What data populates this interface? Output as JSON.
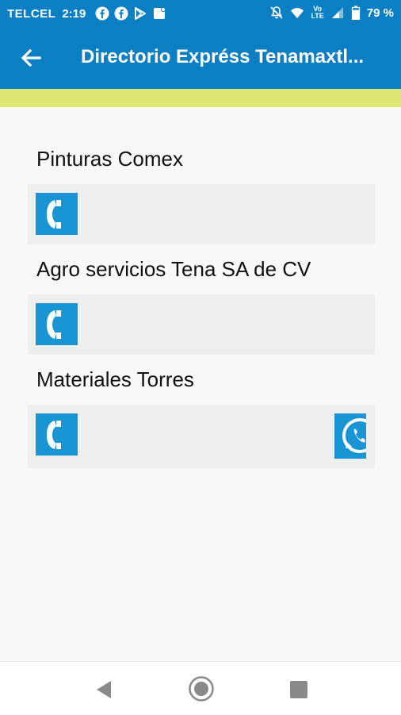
{
  "status_bar": {
    "carrier": "TELCEL",
    "time": "2:19",
    "volte_top": "Vo",
    "volte_bottom": "LTE",
    "battery": "79 %"
  },
  "app_bar": {
    "title": "Directorio Expréss Tenamaxtl...",
    "color": "#0a7fc4",
    "accent_color": "#dde774"
  },
  "entries": [
    {
      "name": "Pinturas Comex",
      "buttons": [
        "phone-icon"
      ]
    },
    {
      "name": "Agro servicios Tena SA de CV",
      "buttons": [
        "phone-icon"
      ]
    },
    {
      "name": "Materiales Torres",
      "buttons": [
        "phone-icon",
        "whatsapp-icon"
      ]
    }
  ],
  "nav_bar": {
    "buttons": [
      "back-triangle-icon",
      "home-circle-icon",
      "recents-square-icon"
    ]
  }
}
